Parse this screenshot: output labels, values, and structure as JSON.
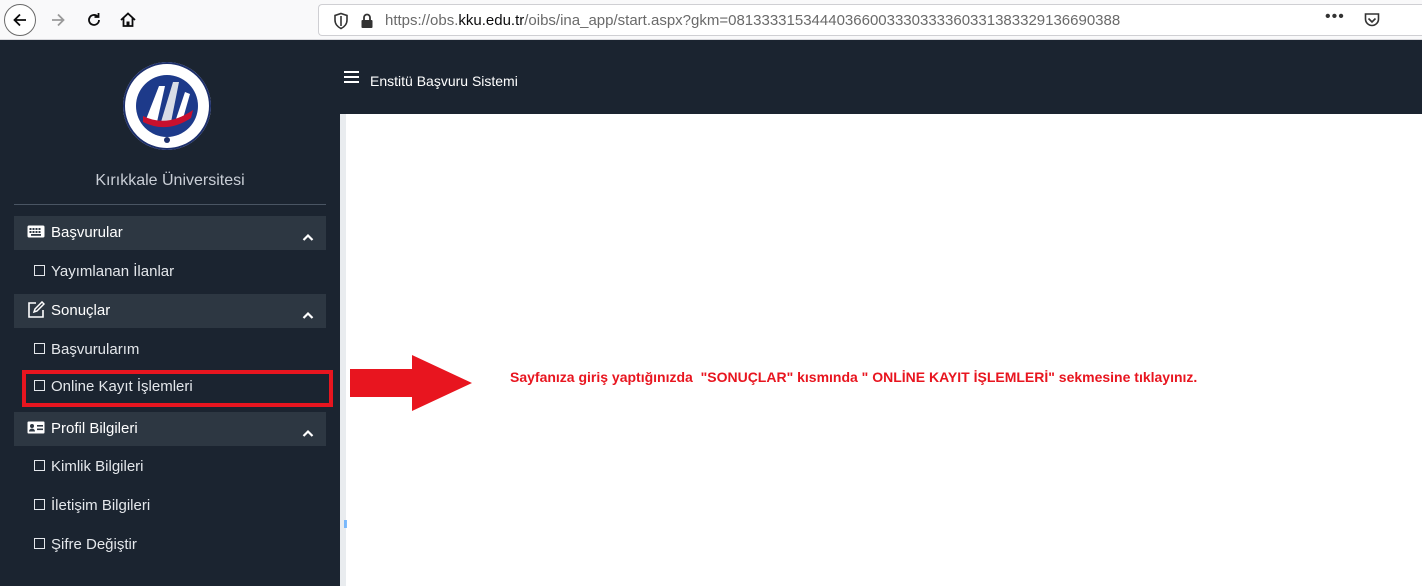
{
  "browser": {
    "url_prefix": "https://obs.",
    "url_domain": "kku.edu.tr",
    "url_path": "/oibs/ina_app/start.aspx?gkm=08133331534440366003330333360331383329136690388",
    "more_label": "•••"
  },
  "topbar": {
    "title": "Enstitü Başvuru Sistemi"
  },
  "sidebar": {
    "university_name": "Kırıkkale Üniversitesi",
    "sections": [
      {
        "label": "Başvurular",
        "icon": "keyboard-icon",
        "items": [
          "Yayımlanan İlanlar"
        ]
      },
      {
        "label": "Sonuçlar",
        "icon": "edit-icon",
        "items": [
          "Başvurularım",
          "Online Kayıt İşlemleri"
        ]
      },
      {
        "label": "Profil Bilgileri",
        "icon": "id-card-icon",
        "items": [
          "Kimlik Bilgileri",
          "İletişim Bilgileri",
          "Şifre Değiştir"
        ]
      }
    ]
  },
  "annotation": {
    "text": "Sayfanıza giriş yaptığınızda  \"SONUÇLAR\" kısmında \" ONLİNE KAYIT İŞLEMLERİ\" sekmesine tıklayınız.",
    "color": "#e8151f"
  },
  "colors": {
    "sidebar_bg": "#1b2430",
    "section_header_bg": "#2d3742",
    "highlight": "#e8151f"
  }
}
